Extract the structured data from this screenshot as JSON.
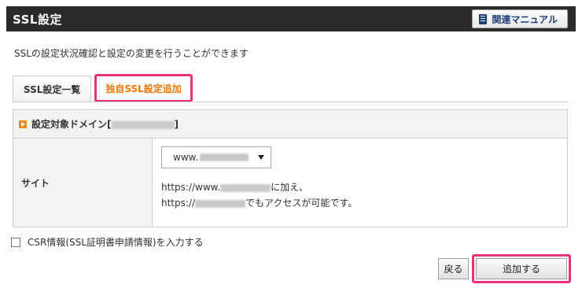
{
  "header": {
    "title": "SSL設定",
    "manual_label": "関連マニュアル"
  },
  "description": "SSLの設定状況確認と設定の変更を行うことができます",
  "tabs": [
    {
      "label": "SSL設定一覧",
      "active": false
    },
    {
      "label": "独自SSL設定追加",
      "active": true
    }
  ],
  "panel": {
    "heading_prefix": "設定対象ドメイン[",
    "heading_suffix": "]",
    "site_label": "サイト",
    "site_select_value": "www.",
    "note_line1_prefix": "https://www.",
    "note_line1_suffix": "に加え、",
    "note_line2_prefix": "https://",
    "note_line2_suffix": "でもアクセスが可能です。"
  },
  "csr_label": "CSR情報(SSL証明書申請情報)を入力する",
  "buttons": {
    "back": "戻る",
    "add": "追加する"
  },
  "colors": {
    "header_bg": "#2b2b2b",
    "accent_orange": "#f0780a",
    "highlight_pink": "#e8317c"
  }
}
